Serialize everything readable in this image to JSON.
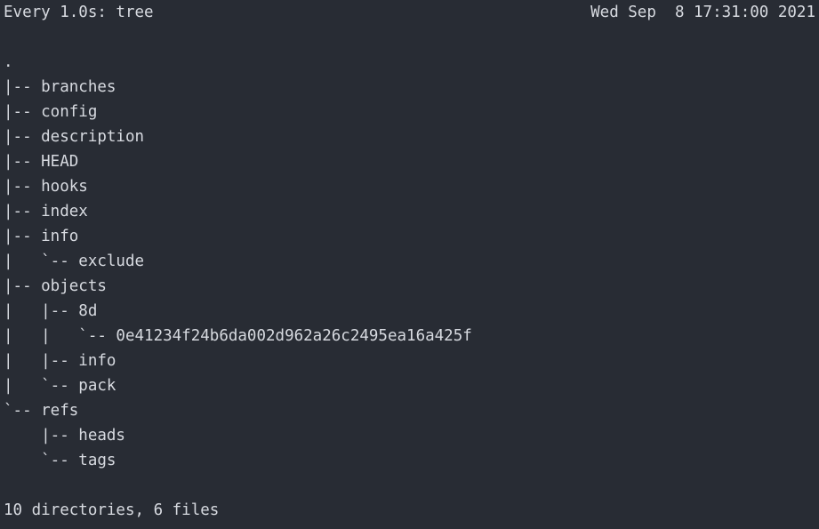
{
  "terminal": {
    "background_color": "#282c34",
    "foreground_color": "#d7dae0",
    "header": {
      "left": "Every 1.0s: tree",
      "right": "Wed Sep  8 17:31:00 2021"
    },
    "tree_lines": [
      ".",
      "|-- branches",
      "|-- config",
      "|-- description",
      "|-- HEAD",
      "|-- hooks",
      "|-- index",
      "|-- info",
      "|   `-- exclude",
      "|-- objects",
      "|   |-- 8d",
      "|   |   `-- 0e41234f24b6da002d962a26c2495ea16a425f",
      "|   |-- info",
      "|   `-- pack",
      "`-- refs",
      "    |-- heads",
      "    `-- tags"
    ],
    "footer": "10 directories, 6 files"
  }
}
